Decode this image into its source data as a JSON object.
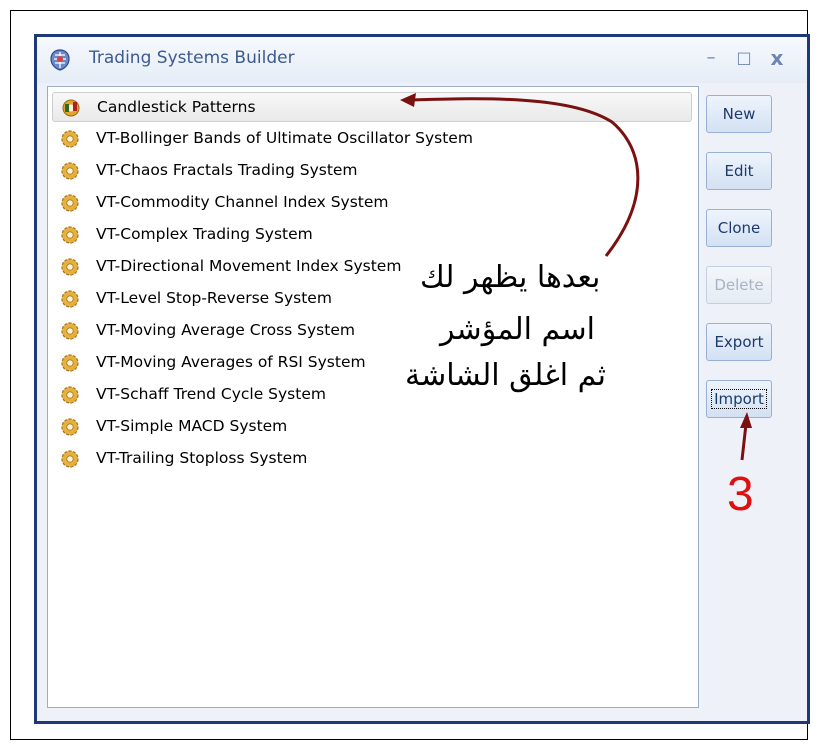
{
  "window": {
    "title": "Trading Systems Builder"
  },
  "window_controls": {
    "minimize": "–",
    "maximize": "□",
    "close": "x"
  },
  "systems": [
    {
      "label": "Candlestick Patterns",
      "icon": "candlestick-gear-icon",
      "selected": true
    },
    {
      "label": "VT-Bollinger Bands of Ultimate Oscillator System",
      "icon": "gear-icon"
    },
    {
      "label": "VT-Chaos Fractals Trading System",
      "icon": "gear-icon"
    },
    {
      "label": "VT-Commodity Channel Index System",
      "icon": "gear-icon"
    },
    {
      "label": "VT-Complex Trading System",
      "icon": "gear-icon"
    },
    {
      "label": "VT-Directional Movement Index System",
      "icon": "gear-icon"
    },
    {
      "label": "VT-Level Stop-Reverse System",
      "icon": "gear-icon"
    },
    {
      "label": "VT-Moving Average Cross System",
      "icon": "gear-icon"
    },
    {
      "label": "VT-Moving Averages of RSI System",
      "icon": "gear-icon"
    },
    {
      "label": "VT-Schaff Trend Cycle System",
      "icon": "gear-icon"
    },
    {
      "label": "VT-Simple MACD System",
      "icon": "gear-icon"
    },
    {
      "label": "VT-Trailing Stoploss System",
      "icon": "gear-icon"
    }
  ],
  "buttons": {
    "new": "New",
    "edit": "Edit",
    "clone": "Clone",
    "delete": "Delete",
    "export": "Export",
    "import": "Import"
  },
  "annotation": {
    "line1": "بعدها يظهر لك",
    "line2": "اسم المؤشر",
    "line3": "ثم اغلق الشاشة",
    "step_number": "3"
  },
  "colors": {
    "window_border": "#1e3878",
    "title_text": "#3c5a92",
    "annotation_arrow": "#7a1010",
    "step_number": "#e01010"
  }
}
